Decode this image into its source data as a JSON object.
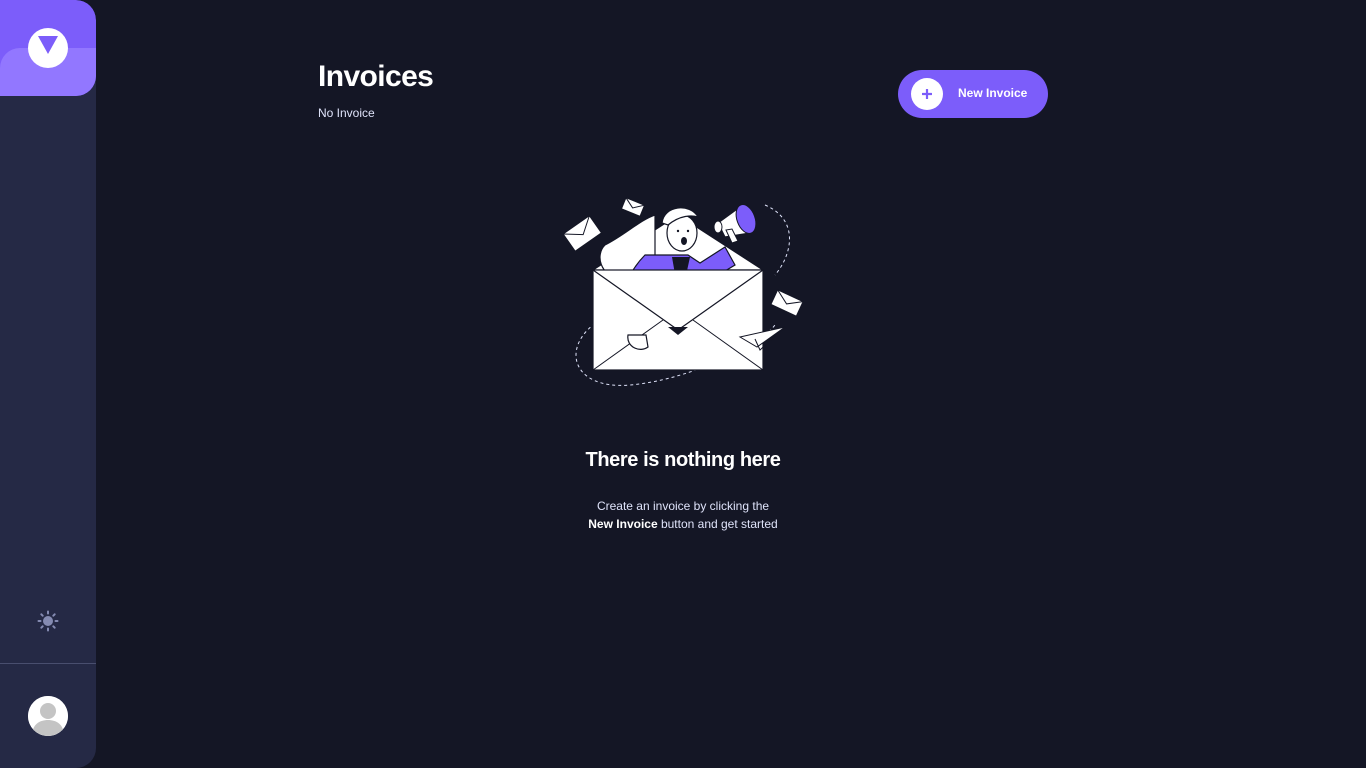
{
  "sidebar": {
    "logo_icon": "app-logo-icon",
    "theme_icon": "sun-icon",
    "avatar_icon": "user-avatar-icon"
  },
  "header": {
    "title": "Invoices",
    "subtitle": "No Invoice",
    "new_invoice_label": "New Invoice",
    "new_invoice_icon": "plus-icon"
  },
  "empty_state": {
    "illustration": "woman-with-megaphone-in-envelope-illustration",
    "heading": "There is nothing here",
    "line1": "Create an invoice by clicking the",
    "line2_bold": "New Invoice",
    "line2_rest": " button and get started"
  },
  "colors": {
    "background": "#141625",
    "sidebar": "#252945",
    "accent": "#7C5DFA",
    "accent_light": "#9277FF",
    "muted_text": "#DFE3FA"
  }
}
